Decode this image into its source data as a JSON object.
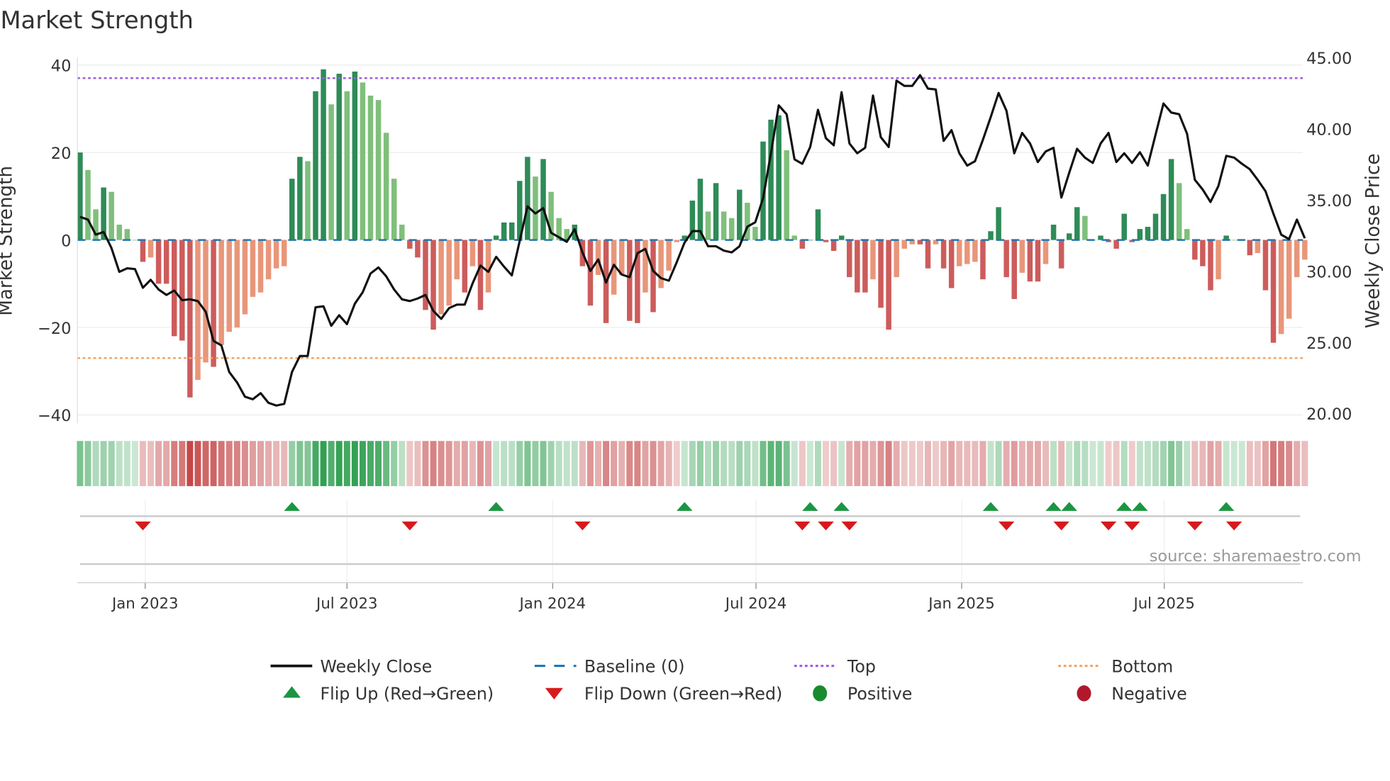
{
  "chart_data": {
    "type": "bar",
    "title": "Market Strength",
    "ylabel": "Market Strength",
    "y2label": "Weekly Close Price",
    "ylim": [
      -44,
      42
    ],
    "y2lim": [
      19.5,
      45.5
    ],
    "yticks": [
      40,
      20,
      0,
      -20,
      -40
    ],
    "ytick_labels": [
      "40",
      "20",
      "0",
      "−20",
      "−40"
    ],
    "y2ticks": [
      45,
      40,
      35,
      30,
      25,
      20
    ],
    "y2tick_labels": [
      "45.00",
      "40.00",
      "35.00",
      "30.00",
      "25.00",
      "20.00"
    ],
    "xtick_labels": [
      "Jan 2023",
      "Jul 2023",
      "Jan 2024",
      "Jul 2024",
      "Jan 2025",
      "Jul 2025"
    ],
    "xtick_week_index": [
      8.3,
      34.0,
      60.2,
      86.1,
      112.3,
      138.1
    ],
    "top_line": 37,
    "bottom_line": -27,
    "baseline": 0,
    "strength": [
      20,
      16,
      7,
      12,
      11,
      3.5,
      2.5,
      0,
      -5,
      -4,
      -10,
      -10,
      -22,
      -23,
      -36,
      -32,
      -28,
      -29,
      -24,
      -21,
      -20,
      -17,
      -13,
      -12,
      -9,
      -6.5,
      -6,
      14,
      19,
      18,
      34,
      39,
      31,
      38,
      34,
      38.5,
      36,
      33,
      32,
      24.5,
      14,
      3.5,
      -2,
      -4,
      -16,
      -20.5,
      -17,
      -15,
      -9,
      -12,
      -6,
      -16,
      -12,
      1,
      4,
      4,
      13.5,
      19,
      14.5,
      18.5,
      11,
      5,
      2.5,
      3.5,
      -6,
      -15,
      -8,
      -19,
      -12.5,
      -8,
      -18.5,
      -19,
      -12,
      -16.5,
      -11,
      -7,
      -0.5,
      1,
      9,
      14,
      6.5,
      13,
      6.5,
      5,
      11.5,
      8.5,
      3,
      22.5,
      27.5,
      28.5,
      20.5,
      1,
      -2,
      0,
      7,
      -0.5,
      -2.5,
      1,
      -8.5,
      -12,
      -12,
      -9,
      -15.5,
      -20.5,
      -8.5,
      -2,
      -1,
      -1,
      -6.5,
      -1,
      -6.5,
      -11,
      -6,
      -5.5,
      -5,
      -9,
      2,
      7.5,
      -8.5,
      -13.5,
      -7.5,
      -9.5,
      -9.5,
      -5.5,
      3.5,
      -6.5,
      1.5,
      7.5,
      5.5,
      0,
      1,
      -0.5,
      -2,
      6,
      -0.5,
      2.5,
      3,
      6,
      10.5,
      18.5,
      13,
      2.5,
      -4.5,
      -6,
      -11.5,
      -9,
      1,
      0,
      0,
      -3.5,
      -3,
      -11.5,
      -23.5,
      -21.5,
      -18,
      -8.5,
      -4.5
    ],
    "weekly_close": [
      33.81,
      33.62,
      32.56,
      32.75,
      31.63,
      29.95,
      30.2,
      30.14,
      28.83,
      29.39,
      28.71,
      28.33,
      28.64,
      27.96,
      28.02,
      27.9,
      27.15,
      25.1,
      24.78,
      22.92,
      22.18,
      21.18,
      21.0,
      21.43,
      20.75,
      20.56,
      20.68,
      22.92,
      24.04,
      24.04,
      27.46,
      27.53,
      26.16,
      26.9,
      26.28,
      27.71,
      28.52,
      29.83,
      30.26,
      29.64,
      28.71,
      28.02,
      27.9,
      28.08,
      28.33,
      27.21,
      26.65,
      27.4,
      27.65,
      27.65,
      29.14,
      30.39,
      29.95,
      31.01,
      30.32,
      29.7,
      32.13,
      34.55,
      34.05,
      34.43,
      32.69,
      32.38,
      32.06,
      32.94,
      31.32,
      30.01,
      30.82,
      29.2,
      30.45,
      29.76,
      29.58,
      31.26,
      31.57,
      30.01,
      29.51,
      29.33,
      30.63,
      32.0,
      32.81,
      32.81,
      31.75,
      31.75,
      31.44,
      31.32,
      31.75,
      33.12,
      33.43,
      35.11,
      38.28,
      41.64,
      41.02,
      37.85,
      37.54,
      38.72,
      41.33,
      39.34,
      38.84,
      42.57,
      38.97,
      38.28,
      38.66,
      42.33,
      39.4,
      38.72,
      43.38,
      43.01,
      43.01,
      43.76,
      42.82,
      42.76,
      39.15,
      39.9,
      38.28,
      37.41,
      37.72,
      39.22,
      40.83,
      42.51,
      41.27,
      38.28,
      39.71,
      38.97,
      37.66,
      38.41,
      38.66,
      35.17,
      36.92,
      38.59,
      37.97,
      37.6,
      38.97,
      39.71,
      37.66,
      38.28,
      37.6,
      38.35,
      37.41,
      39.59,
      41.77,
      41.14,
      41.02,
      39.65,
      36.42,
      35.73,
      34.86,
      35.98,
      38.1,
      37.97,
      37.54,
      37.16,
      36.42,
      35.61,
      34.05,
      32.56,
      32.25,
      33.62,
      32.31
    ],
    "flip_up_week_index": [
      27,
      53,
      77,
      93,
      97,
      116,
      124,
      126,
      133,
      135,
      146
    ],
    "flip_down_week_index": [
      8,
      42,
      64,
      92,
      95,
      98,
      118,
      125,
      131,
      134,
      142,
      147
    ],
    "source": "source: sharemaestro.com",
    "legend": [
      {
        "label": "Weekly Close",
        "kind": "line",
        "color": "#111111"
      },
      {
        "label": "Baseline (0)",
        "kind": "dash",
        "color": "#1f77b4"
      },
      {
        "label": "Top",
        "kind": "dot",
        "color": "#9b5de5"
      },
      {
        "label": "Bottom",
        "kind": "dot",
        "color": "#f4a261"
      },
      {
        "label": "Flip Up (Red→Green)",
        "kind": "up",
        "color": "#1a9641"
      },
      {
        "label": "Flip Down (Green→Red)",
        "kind": "down",
        "color": "#d7191c"
      },
      {
        "label": "Positive",
        "kind": "circle",
        "color": "#1a8a2e"
      },
      {
        "label": "Negative",
        "kind": "circle",
        "color": "#b2182b"
      }
    ],
    "legend_placement": "bottom",
    "colors": {
      "pos_dark": "#2e8b57",
      "pos_light": "#7fbf7b",
      "neg_dark": "#cd5c5c",
      "neg_light": "#e9967a"
    }
  }
}
